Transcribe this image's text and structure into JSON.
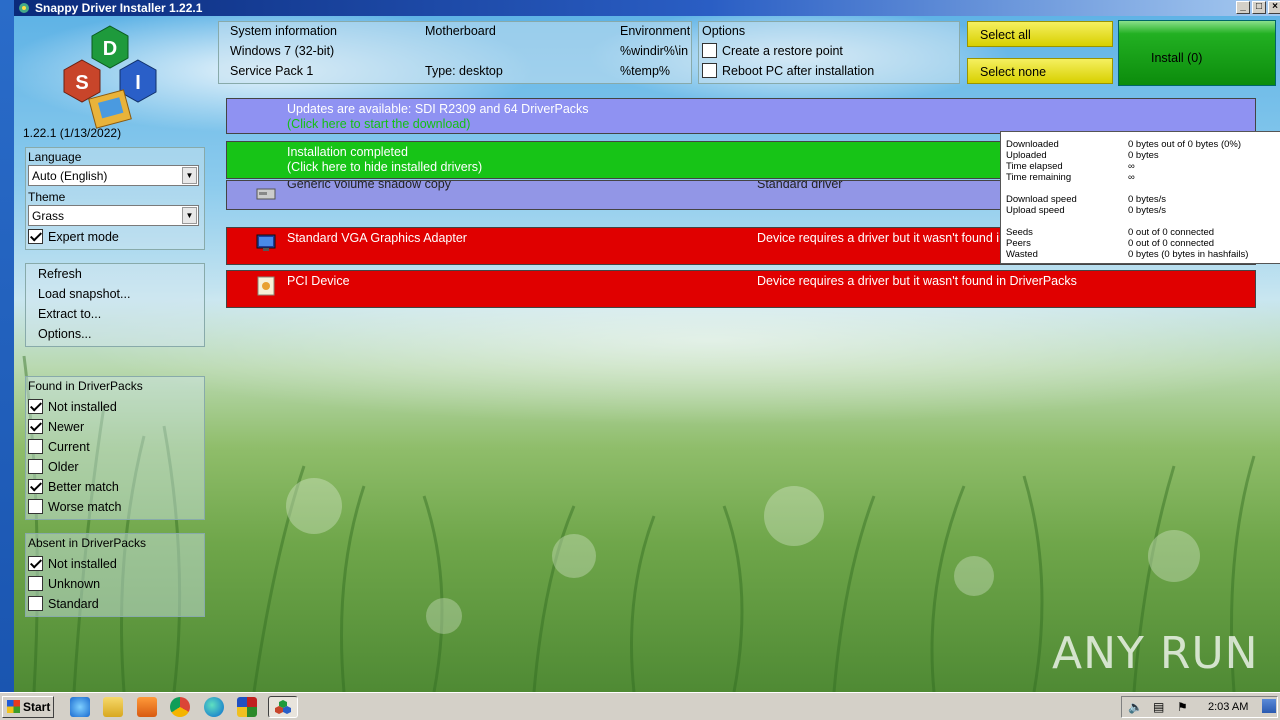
{
  "window": {
    "title": "Snappy Driver Installer 1.22.1"
  },
  "version_label": "1.22.1 (1/13/2022)",
  "language": {
    "label": "Language",
    "value": "Auto (English)"
  },
  "theme": {
    "label": "Theme",
    "value": "Grass"
  },
  "expert_mode": {
    "label": "Expert mode",
    "checked": true
  },
  "menu": [
    "Refresh",
    "Load snapshot...",
    "Extract to...",
    "Options..."
  ],
  "found": {
    "title": "Found in DriverPacks",
    "items": [
      {
        "label": "Not installed",
        "checked": true
      },
      {
        "label": "Newer",
        "checked": true
      },
      {
        "label": "Current",
        "checked": false
      },
      {
        "label": "Older",
        "checked": false
      },
      {
        "label": "Better match",
        "checked": true
      },
      {
        "label": "Worse match",
        "checked": false
      }
    ]
  },
  "absent": {
    "title": "Absent in DriverPacks",
    "items": [
      {
        "label": "Not installed",
        "checked": true
      },
      {
        "label": "Unknown",
        "checked": false
      },
      {
        "label": "Standard",
        "checked": false
      }
    ]
  },
  "sysinfo": {
    "col1": [
      "System information",
      "Windows 7 (32-bit)",
      "Service Pack 1"
    ],
    "col2": [
      "Motherboard",
      "",
      "Type: desktop"
    ],
    "col3": [
      "Environment",
      "%windir%\\in",
      "%temp%"
    ]
  },
  "options": {
    "title": "Options",
    "items": [
      {
        "label": "Create a restore point",
        "checked": false
      },
      {
        "label": "Reboot PC after installation",
        "checked": false
      }
    ]
  },
  "buttons": {
    "select_all": "Select all",
    "select_none": "Select none",
    "install": "Install (0)"
  },
  "rows": {
    "updates": {
      "line1": "Updates are available: SDI R2309 and 64 DriverPacks",
      "line2": "(Click here to start the download)"
    },
    "installed": {
      "line1": "Installation completed",
      "line2": "(Click here to hide installed drivers)"
    },
    "shadow": {
      "name": "Generic volume shadow copy",
      "status": "Standard driver"
    },
    "vga": {
      "name": "Standard VGA Graphics Adapter",
      "status": "Device requires a driver but it wasn't found in DriverPacks"
    },
    "pci": {
      "name": "PCI Device",
      "status": "Device requires a driver but it wasn't found in DriverPacks"
    }
  },
  "tooltip": [
    {
      "k": "Downloaded",
      "v": "0 bytes out of 0 bytes (0%)"
    },
    {
      "k": "Uploaded",
      "v": "0 bytes"
    },
    {
      "k": "Time elapsed",
      "v": "∞"
    },
    {
      "k": "Time remaining",
      "v": "∞"
    },
    {
      "k": "Download speed",
      "v": "0 bytes/s"
    },
    {
      "k": "Upload speed",
      "v": "0 bytes/s"
    },
    {
      "k": "Seeds",
      "v": "0 out of 0 connected"
    },
    {
      "k": "Peers",
      "v": "0 out of 0 connected"
    },
    {
      "k": "Wasted",
      "v": "0 bytes (0 bytes in hashfails)"
    }
  ],
  "taskbar": {
    "start": "Start",
    "clock": "2:03 AM"
  },
  "watermark": "ANY RUN",
  "logo_letters": [
    "D",
    "S",
    "I"
  ],
  "colors": {
    "row_blue": "#8f92f2",
    "row_green": "#17c417",
    "row_red": "#e00000",
    "link_green": "#13c013"
  }
}
